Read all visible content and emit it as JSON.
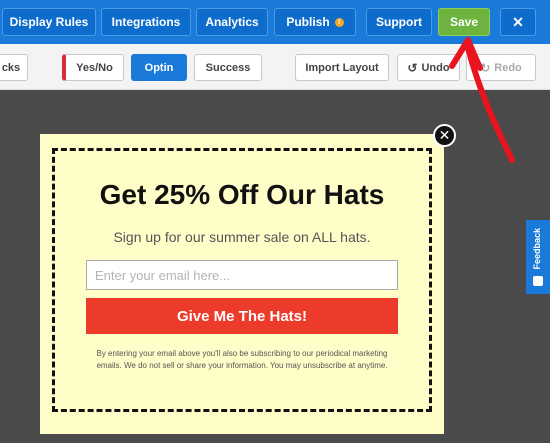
{
  "topbar": {
    "display_rules": "Display Rules",
    "integrations": "Integrations",
    "analytics": "Analytics",
    "publish": "Publish",
    "support": "Support",
    "save": "Save",
    "close": "✕"
  },
  "toolbar": {
    "blocks_partial": "cks",
    "yes_no": "Yes/No",
    "optin": "Optin",
    "success": "Success",
    "import_layout": "Import Layout",
    "undo": "Undo",
    "redo": "Redo"
  },
  "popup": {
    "headline": "Get 25% Off Our Hats",
    "subline": "Sign up for our summer sale on ALL hats.",
    "email_placeholder": "Enter your email here...",
    "cta": "Give Me The Hats!",
    "disclaimer": "By entering your email above you'll also be subscribing to our periodical marketing emails. We do not sell or share your information. You may unsubscribe at anytime."
  },
  "feedback": {
    "label": "Feedback"
  },
  "colors": {
    "brand_blue": "#1a7ad9",
    "save_green": "#6db33f",
    "cta_red": "#ec3a2b",
    "popup_bg": "#fffdc8",
    "annotation_red": "#e8141f"
  }
}
